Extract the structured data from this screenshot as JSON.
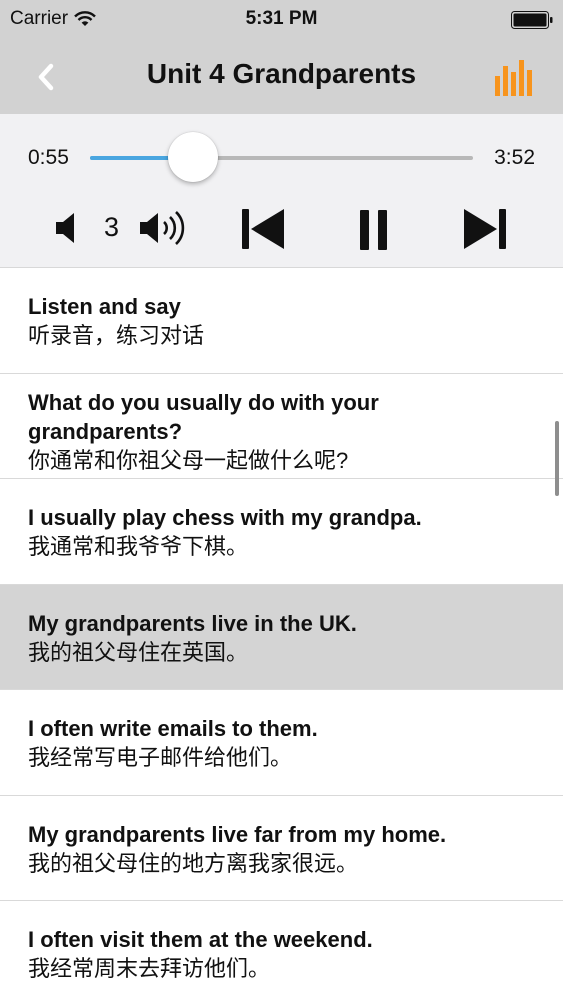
{
  "status_bar": {
    "carrier": "Carrier",
    "time": "5:31 PM"
  },
  "nav": {
    "title": "Unit 4  Grandparents",
    "back_icon": "chevron-left-icon",
    "right_icon": "bar-chart-icon",
    "accent": "#f7941d"
  },
  "player": {
    "current_time": "0:55",
    "total_time": "3:52",
    "progress": 0.27,
    "volume_level": "3",
    "track_color": "#4aa6e0"
  },
  "list": {
    "items": [
      {
        "en": "Listen and say",
        "zh": "听录音，练习对话",
        "selected": false
      },
      {
        "en": "What do you usually do with your grandparents?",
        "zh": "你通常和你祖父母一起做什么呢?",
        "selected": false
      },
      {
        "en": "I usually play chess with my grandpa.",
        "zh": "我通常和我爷爷下棋。",
        "selected": false
      },
      {
        "en": "My grandparents live in the UK.",
        "zh": "我的祖父母住在英国。",
        "selected": true
      },
      {
        "en": "I often write emails to them.",
        "zh": "我经常写电子邮件给他们。",
        "selected": false
      },
      {
        "en": "My grandparents live far from my home.",
        "zh": "我的祖父母住的地方离我家很远。",
        "selected": false
      },
      {
        "en": "I often visit them at the weekend.",
        "zh": "我经常周末去拜访他们。",
        "selected": false
      }
    ]
  }
}
